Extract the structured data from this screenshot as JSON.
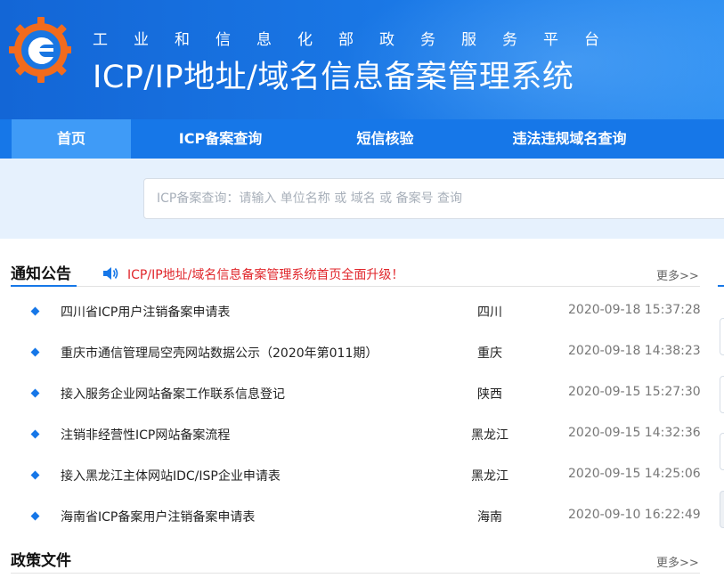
{
  "header": {
    "subtitle": "工业和信息化部政务服务平台",
    "title": "ICP/IP地址/域名信息备案管理系统"
  },
  "nav": {
    "items": [
      {
        "label": "首页",
        "active": true
      },
      {
        "label": "ICP备案查询"
      },
      {
        "label": "短信核验"
      },
      {
        "label": "违法违规域名查询"
      }
    ]
  },
  "search": {
    "placeholder": "ICP备案查询：请输入 单位名称 或 域名 或 备案号 查询"
  },
  "notice": {
    "title": "通知公告",
    "marquee": "ICP/IP地址/域名信息备案管理系统首页全面升级！",
    "more": "更多>>",
    "items": [
      {
        "title": "四川省ICP用户注销备案申请表",
        "region": "四川",
        "date": "2020-09-18 15:37:28"
      },
      {
        "title": "重庆市通信管理局空壳网站数据公示（2020年第011期）",
        "region": "重庆",
        "date": "2020-09-18 14:38:23"
      },
      {
        "title": "接入服务企业网站备案工作联系信息登记",
        "region": "陕西",
        "date": "2020-09-15 15:27:30"
      },
      {
        "title": "注销非经营性ICP网站备案流程",
        "region": "黑龙江",
        "date": "2020-09-15 14:32:36"
      },
      {
        "title": "接入黑龙江主体网站IDC/ISP企业申请表",
        "region": "黑龙江",
        "date": "2020-09-15 14:25:06"
      },
      {
        "title": "海南省ICP备案用户注销备案申请表",
        "region": "海南",
        "date": "2020-09-10 16:22:49"
      }
    ]
  },
  "policy": {
    "title": "政策文件",
    "more": "更多>>"
  },
  "colors": {
    "primary": "#1677e8",
    "nav_active": "#3f9bf7",
    "alert": "#e0262b",
    "search_band": "#e6f1fd"
  },
  "icons": {
    "logo": "site-logo-gear",
    "speaker": "speaker-icon",
    "bullet": "diamond-bullet-icon"
  }
}
